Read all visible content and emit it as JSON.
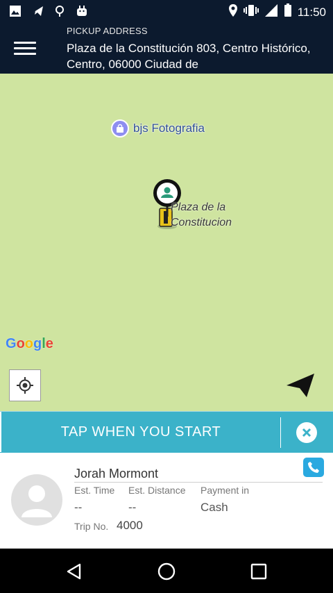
{
  "status_bar": {
    "time": "11:50",
    "icons": [
      "photo-icon",
      "airplane-icon",
      "pin-icon",
      "android-icon",
      "location-icon",
      "vibrate-icon",
      "signal-icon",
      "battery-icon"
    ]
  },
  "header": {
    "pickup_label": "PICKUP ADDRESS",
    "pickup_address": "Plaza de la Constitución 803, Centro Histórico, Centro, 06000 Ciudad de"
  },
  "map": {
    "poi_label": "bjs Fotografia",
    "place_label_line1": "Plaza de la",
    "place_label_line2": "Constitucion",
    "attribution": "Google",
    "colors": {
      "land": "#cfe4a0",
      "poi": "#8e8ef0"
    }
  },
  "start_bar": {
    "label": "TAP WHEN YOU START",
    "color": "#3bb2c9"
  },
  "trip_card": {
    "driver_name": "Jorah Mormont",
    "est_time_label": "Est. Time",
    "est_time_value": "--",
    "est_distance_label": "Est. Distance",
    "est_distance_value": "--",
    "payment_label": "Payment in",
    "payment_value": "Cash",
    "trip_no_label": "Trip No.",
    "trip_no_value": "4000"
  },
  "colors": {
    "header_bg": "#0c1a2e",
    "accent": "#3bb2c9",
    "call": "#2aa9e0"
  }
}
